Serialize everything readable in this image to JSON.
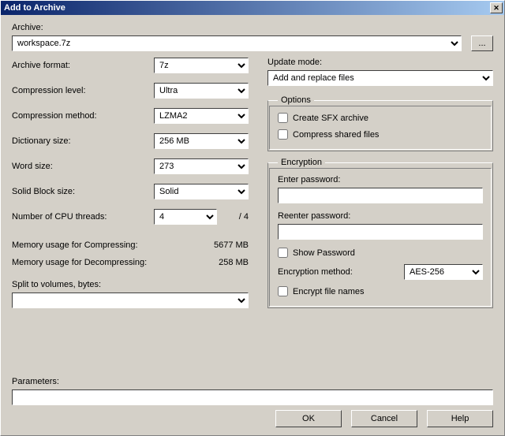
{
  "title": "Add to Archive",
  "archive": {
    "label": "Archive:",
    "value": "workspace.7z",
    "browse": "..."
  },
  "left": {
    "format": {
      "label": "Archive format:",
      "value": "7z"
    },
    "level": {
      "label": "Compression level:",
      "value": "Ultra"
    },
    "method": {
      "label": "Compression method:",
      "value": "LZMA2"
    },
    "dict": {
      "label": "Dictionary size:",
      "value": "256 MB"
    },
    "word": {
      "label": "Word size:",
      "value": "273"
    },
    "solid": {
      "label": "Solid Block size:",
      "value": "Solid"
    },
    "threads": {
      "label": "Number of CPU threads:",
      "value": "4",
      "max": "/ 4"
    },
    "memcomp": {
      "label": "Memory usage for Compressing:",
      "value": "5677 MB"
    },
    "memdecomp": {
      "label": "Memory usage for Decompressing:",
      "value": "258 MB"
    },
    "split": {
      "label": "Split to volumes, bytes:",
      "value": ""
    }
  },
  "right": {
    "update": {
      "label": "Update mode:",
      "value": "Add and replace files"
    },
    "options": {
      "legend": "Options",
      "sfx": "Create SFX archive",
      "shared": "Compress shared files"
    },
    "enc": {
      "legend": "Encryption",
      "enter": "Enter password:",
      "reenter": "Reenter password:",
      "show": "Show Password",
      "methodlbl": "Encryption method:",
      "method": "AES-256",
      "encnames": "Encrypt file names"
    }
  },
  "params": {
    "label": "Parameters:",
    "value": ""
  },
  "buttons": {
    "ok": "OK",
    "cancel": "Cancel",
    "help": "Help"
  }
}
